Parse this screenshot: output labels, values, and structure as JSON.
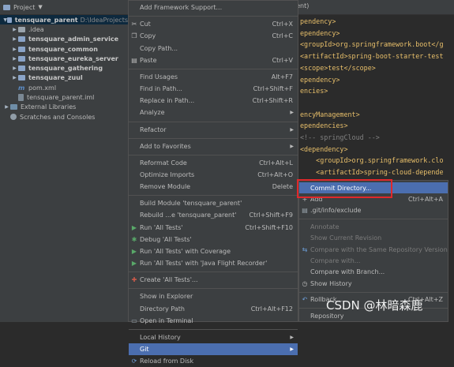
{
  "project_panel": {
    "title": "Project",
    "tree": [
      {
        "name": "tensquare_parent",
        "path": "D:\\IdeaProjects",
        "bold": true,
        "arrow": "▼",
        "icon": "folder-icon",
        "indent": 0,
        "selected": true
      },
      {
        "name": ".idea",
        "bold": false,
        "arrow": "▶",
        "icon": "folder-icon",
        "indent": 1
      },
      {
        "name": "tensquare_admin_service",
        "bold": true,
        "arrow": "▶",
        "icon": "folder-icon",
        "indent": 1
      },
      {
        "name": "tensquare_common",
        "bold": true,
        "arrow": "▶",
        "icon": "folder-icon",
        "indent": 1
      },
      {
        "name": "tensquare_eureka_server",
        "bold": true,
        "arrow": "▶",
        "icon": "folder-icon",
        "indent": 1
      },
      {
        "name": "tensquare_gathering",
        "bold": true,
        "arrow": "▶",
        "icon": "folder-icon",
        "indent": 1
      },
      {
        "name": "tensquare_zuul",
        "bold": true,
        "arrow": "▶",
        "icon": "folder-icon",
        "indent": 1
      },
      {
        "name": "pom.xml",
        "bold": false,
        "arrow": "",
        "icon": "maven-icon",
        "indent": 1
      },
      {
        "name": "tensquare_parent.iml",
        "bold": false,
        "arrow": "",
        "icon": "iml-file-icon",
        "indent": 1
      },
      {
        "name": "External Libraries",
        "bold": false,
        "arrow": "▶",
        "icon": "library-icon",
        "indent": 0
      },
      {
        "name": "Scratches and Consoles",
        "bold": false,
        "arrow": "",
        "icon": "scratches-icon",
        "indent": 0
      }
    ]
  },
  "editor": {
    "tab_fragment": "rent)",
    "lines": [
      "pendency>",
      "ependency>",
      "<groupId>org.springframework.boot</g",
      "<artifactId>spring-boot-starter-test",
      "<scope>test</scope>",
      "ependency>",
      "encies>",
      "",
      "encyManagement>",
      "ependencies>",
      "<!-- springCloud -->",
      "<dependency>",
      "    <groupId>org.springframework.clo",
      "    <artifactId>spring-cloud-depende",
      "    <version>${spring-cloud.version}"
    ]
  },
  "context_menu": {
    "items": [
      {
        "label": "Add Framework Support...",
        "shortcut": "",
        "icon": ""
      },
      {
        "sep": true
      },
      {
        "label": "Cut",
        "shortcut": "Ctrl+X",
        "icon": "cut-icon"
      },
      {
        "label": "Copy",
        "shortcut": "Ctrl+C",
        "icon": "copy-icon"
      },
      {
        "label": "Copy Path...",
        "shortcut": "",
        "icon": ""
      },
      {
        "label": "Paste",
        "shortcut": "Ctrl+V",
        "icon": "paste-icon"
      },
      {
        "sep": true
      },
      {
        "label": "Find Usages",
        "shortcut": "Alt+F7",
        "icon": ""
      },
      {
        "label": "Find in Path...",
        "shortcut": "Ctrl+Shift+F",
        "icon": ""
      },
      {
        "label": "Replace in Path...",
        "shortcut": "Ctrl+Shift+R",
        "icon": ""
      },
      {
        "label": "Analyze",
        "shortcut": "",
        "icon": "",
        "submenu": true
      },
      {
        "sep": true
      },
      {
        "label": "Refactor",
        "shortcut": "",
        "icon": "",
        "submenu": true
      },
      {
        "sep": true
      },
      {
        "label": "Add to Favorites",
        "shortcut": "",
        "icon": "",
        "submenu": true
      },
      {
        "sep": true
      },
      {
        "label": "Reformat Code",
        "shortcut": "Ctrl+Alt+L",
        "icon": ""
      },
      {
        "label": "Optimize Imports",
        "shortcut": "Ctrl+Alt+O",
        "icon": ""
      },
      {
        "label": "Remove Module",
        "shortcut": "Delete",
        "icon": ""
      },
      {
        "sep": true
      },
      {
        "label": "Build Module 'tensquare_parent'",
        "shortcut": "",
        "icon": ""
      },
      {
        "label": "Rebuild ...e 'tensquare_parent'",
        "shortcut": "Ctrl+Shift+F9",
        "icon": ""
      },
      {
        "label": "Run 'All Tests'",
        "shortcut": "Ctrl+Shift+F10",
        "icon": "run-icon"
      },
      {
        "label": "Debug 'All Tests'",
        "shortcut": "",
        "icon": "debug-icon"
      },
      {
        "label": "Run 'All Tests' with Coverage",
        "shortcut": "",
        "icon": "coverage-icon"
      },
      {
        "label": "Run 'All Tests' with 'Java Flight Recorder'",
        "shortcut": "",
        "icon": "profiler-icon"
      },
      {
        "sep": true
      },
      {
        "label": "Create 'All Tests'...",
        "shortcut": "",
        "icon": "create-test-icon"
      },
      {
        "sep": true
      },
      {
        "label": "Show in Explorer",
        "shortcut": "",
        "icon": ""
      },
      {
        "label": "Directory Path",
        "shortcut": "Ctrl+Alt+F12",
        "icon": ""
      },
      {
        "label": "Open in Terminal",
        "shortcut": "",
        "icon": "terminal-icon"
      },
      {
        "sep": true
      },
      {
        "label": "Local History",
        "shortcut": "",
        "icon": "",
        "submenu": true
      },
      {
        "label": "Git",
        "shortcut": "",
        "icon": "",
        "submenu": true,
        "highlighted": true
      },
      {
        "label": "Reload from Disk",
        "shortcut": "",
        "icon": "reload-icon"
      }
    ]
  },
  "git_submenu": {
    "items": [
      {
        "label": "Commit Directory...",
        "shortcut": "",
        "icon": "",
        "enabled": true,
        "highlighted": true
      },
      {
        "label": "Add",
        "shortcut": "Ctrl+Alt+A",
        "icon": "plus-icon",
        "enabled": true
      },
      {
        "label": ".git/info/exclude",
        "shortcut": "",
        "icon": "git-icon",
        "enabled": true
      },
      {
        "sep": true
      },
      {
        "label": "Annotate",
        "shortcut": "",
        "icon": "",
        "enabled": false
      },
      {
        "label": "Show Current Revision",
        "shortcut": "",
        "icon": "",
        "enabled": false
      },
      {
        "label": "Compare with the Same Repository Version",
        "shortcut": "",
        "icon": "compare-icon",
        "enabled": false
      },
      {
        "label": "Compare with...",
        "shortcut": "",
        "icon": "",
        "enabled": false
      },
      {
        "label": "Compare with Branch...",
        "shortcut": "",
        "icon": "",
        "enabled": true
      },
      {
        "label": "Show History",
        "shortcut": "",
        "icon": "history-icon",
        "enabled": true
      },
      {
        "sep": true
      },
      {
        "label": "Rollback...",
        "shortcut": "Ctrl+Alt+Z",
        "icon": "rollback-icon",
        "enabled": true
      },
      {
        "sep": true
      },
      {
        "label": "Repository",
        "shortcut": "",
        "icon": "",
        "enabled": true
      }
    ]
  },
  "watermark": "CSDN @林暗森鹿",
  "colors": {
    "highlight": "#4b6eaf",
    "menu_bg": "#3c3f41",
    "editor_bg": "#2b2b2b",
    "annotation_box": "#e0282b"
  }
}
